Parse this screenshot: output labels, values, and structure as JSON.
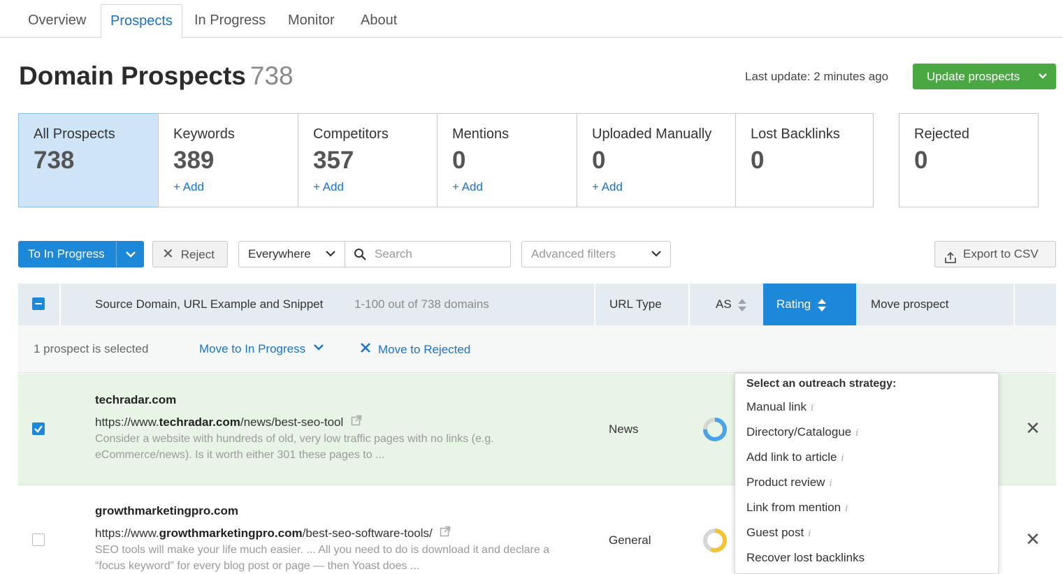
{
  "tabs": [
    {
      "label": "Overview"
    },
    {
      "label": "Prospects"
    },
    {
      "label": "In Progress"
    },
    {
      "label": "Monitor"
    },
    {
      "label": "About"
    }
  ],
  "header": {
    "title": "Domain Prospects",
    "count": "738",
    "last_update": "Last update: 2 minutes ago",
    "update_button": "Update prospects"
  },
  "cards": [
    {
      "label": "All Prospects",
      "value": "738",
      "add": ""
    },
    {
      "label": "Keywords",
      "value": "389",
      "add": "+ Add"
    },
    {
      "label": "Competitors",
      "value": "357",
      "add": "+ Add"
    },
    {
      "label": "Mentions",
      "value": "0",
      "add": "+ Add"
    },
    {
      "label": "Uploaded Manually",
      "value": "0",
      "add": "+ Add"
    },
    {
      "label": "Lost Backlinks",
      "value": "0",
      "add": ""
    },
    {
      "label": "Rejected",
      "value": "0",
      "add": ""
    }
  ],
  "toolbar": {
    "to_in_progress": "To In Progress",
    "reject": "Reject",
    "scope_selected": "Everywhere",
    "search_placeholder": "Search",
    "advanced_filters": "Advanced filters",
    "export": "Export to CSV"
  },
  "table": {
    "col_source": "Source Domain, URL Example and Snippet",
    "range": "1-100 out of 738 domains",
    "col_url_type": "URL Type",
    "col_as": "AS",
    "col_rating": "Rating",
    "col_move": "Move prospect"
  },
  "selection": {
    "count": "1 prospect is selected",
    "move_in_progress": "Move to In Progress",
    "move_rejected": "Move to Rejected"
  },
  "rows": [
    {
      "domain": "techradar.com",
      "url_pre": "https://www.",
      "url_bold": "techradar.com",
      "url_post": "/news/best-seo-tool",
      "snippet": "Consider a website with hundreds of old, very low traffic pages with no links (e.g. eCommerce/news). Is it worth either 301 these pages to ...",
      "url_type": "News",
      "selected": true
    },
    {
      "domain": "growthmarketingpro.com",
      "url_pre": "https://www.",
      "url_bold": "growthmarketingpro.com",
      "url_post": "/best-seo-software-tools/",
      "snippet": "SEO tools will make your life much easier. ... All you need to do is download it and declare a “focus keyword” for every blog post or page — then Yoast does ...",
      "url_type": "General",
      "selected": false
    }
  ],
  "dropdown": {
    "title": "Select an outreach strategy:",
    "items": [
      {
        "label": "Manual link"
      },
      {
        "label": "Directory/Catalogue"
      },
      {
        "label": "Add link to article"
      },
      {
        "label": "Product review"
      },
      {
        "label": "Link from mention"
      },
      {
        "label": "Guest post"
      },
      {
        "label": "Recover lost backlinks"
      }
    ],
    "info_glyph": "i"
  },
  "colors": {
    "primary": "#1e88d8",
    "success": "#4aa843",
    "selected_row": "#e8f5e6",
    "active_card": "#cfe5f7"
  }
}
